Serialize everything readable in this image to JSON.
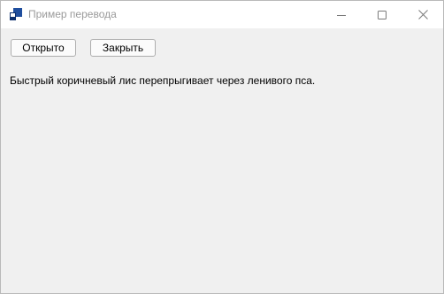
{
  "window": {
    "title": "Пример перевода",
    "app_icon": "app-window-icon",
    "controls": {
      "minimize_icon": "minimize-icon",
      "maximize_icon": "maximize-icon",
      "close_icon": "close-icon"
    }
  },
  "toolbar": {
    "open_label": "Открыто",
    "close_label": "Закрыть"
  },
  "content": {
    "message": "Быстрый коричневый лис перепрыгивает через ленивого пса."
  },
  "colors": {
    "titlebar_bg": "#ffffff",
    "client_bg": "#f0f0f0",
    "title_text": "#9a9a9a",
    "icon_blue": "#1f4e9e"
  }
}
